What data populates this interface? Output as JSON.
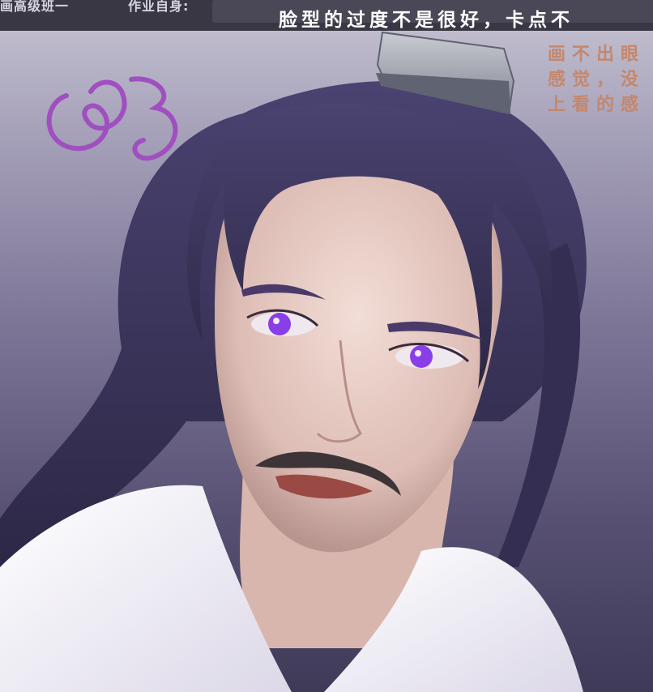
{
  "header": {
    "class_label": "画高级班一",
    "homework_label": "作业自身:",
    "critique_title": "脸型的过度不是很好，卡点不"
  },
  "notes": {
    "line1": "画不出眼",
    "line2": "感觉，没",
    "line3": "上看的感"
  },
  "colors": {
    "header_bg": "#3a3744",
    "title_text": "#ffffff",
    "note_text": "#c4876c",
    "signature": "#a04fc0",
    "hair": "#3b3456",
    "eye": "#8a3ee8"
  },
  "icons": {
    "signature": "handwritten-signature",
    "headpiece": "silver-hair-crown"
  }
}
